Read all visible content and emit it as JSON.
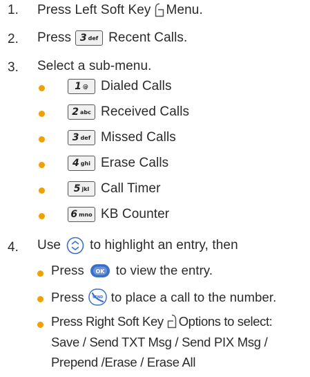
{
  "steps": {
    "s1": {
      "num": "1.",
      "prefix": "Press Left Soft Key",
      "suffix": "Menu."
    },
    "s2": {
      "num": "2.",
      "prefix": "Press",
      "key": {
        "number": "3",
        "letters": "def"
      },
      "suffix": "Recent Calls."
    },
    "s3": {
      "num": "3.",
      "text": "Select a sub-menu."
    },
    "submenu": [
      {
        "key_number": "1",
        "key_letters": "@",
        "label": "Dialed Calls"
      },
      {
        "key_number": "2",
        "key_letters": "abc",
        "label": "Received Calls"
      },
      {
        "key_number": "3",
        "key_letters": "def",
        "label": "Missed Calls"
      },
      {
        "key_number": "4",
        "key_letters": "ghi",
        "label": "Erase Calls"
      },
      {
        "key_number": "5",
        "key_letters": "jkl",
        "label": "Call Timer"
      },
      {
        "key_number": "6",
        "key_letters": "mno",
        "label": "KB Counter"
      }
    ],
    "s4": {
      "num": "4.",
      "prefix": "Use",
      "suffix": "to highlight an entry, then"
    },
    "sub4": {
      "a": {
        "prefix": "Press",
        "suffix": "to view the entry."
      },
      "b": {
        "prefix": "Press",
        "suffix": "to place a call to the number."
      },
      "c": {
        "prefix": "Press Right Soft Key",
        "suffix": "Options to select:",
        "line2": "Save / Send TXT Msg / Send PIX Msg /",
        "line3": "Prepend /Erase / Erase All"
      }
    }
  },
  "icons": {
    "left_soft_key": "left-soft-key-icon",
    "right_soft_key": "right-soft-key-icon",
    "nav_key": "navigation-key-icon",
    "ok_key": "ok-key-icon",
    "send_key": "send-key-icon",
    "ok_label": "OK",
    "send_label": "SEND"
  },
  "colors": {
    "bullet": "#f0a000",
    "text": "#2a2a2a",
    "icon_blue": "#3a6fc8"
  }
}
